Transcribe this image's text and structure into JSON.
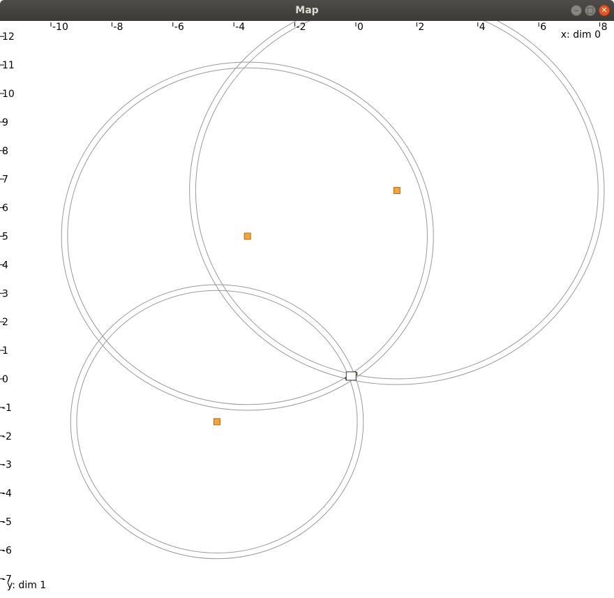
{
  "window": {
    "title": "Map",
    "buttons": {
      "minimize_icon": "minimize-icon",
      "maximize_icon": "maximize-icon",
      "close_icon": "close-icon"
    }
  },
  "plot": {
    "x_label": "x: dim 0",
    "y_label": "y: dim 1",
    "x_ticks": [
      -10,
      -8,
      -6,
      -4,
      -2,
      0,
      2,
      4,
      6,
      8
    ],
    "y_ticks": [
      12,
      11,
      10,
      9,
      8,
      7,
      6,
      5,
      4,
      3,
      2,
      1,
      0,
      -1,
      -2,
      -3,
      -4,
      -5,
      -6,
      -7
    ],
    "x_range": [
      -11.8,
      8.3
    ],
    "y_range": [
      -7.2,
      12.3
    ],
    "colors": {
      "landmark_fill": "#f5a33c",
      "landmark_stroke": "#b06b10",
      "circle_stroke": "#999999",
      "robot_fill": "#ffff00"
    }
  },
  "chart_data": {
    "type": "scatter",
    "landmarks": [
      {
        "x": -3.6,
        "y": 5.0
      },
      {
        "x": 1.3,
        "y": 6.6
      },
      {
        "x": -4.6,
        "y": -1.5
      }
    ],
    "range_circles": [
      {
        "cx": -3.6,
        "cy": 5.0,
        "r_inner": 5.9,
        "r_outer": 6.1
      },
      {
        "cx": 1.3,
        "cy": 6.6,
        "r_inner": 6.6,
        "r_outer": 6.8
      },
      {
        "cx": -4.6,
        "cy": -1.5,
        "r_inner": 4.6,
        "r_outer": 4.8
      }
    ],
    "robot": {
      "x": -0.2,
      "y": 0.1,
      "heading_deg": 30
    }
  }
}
